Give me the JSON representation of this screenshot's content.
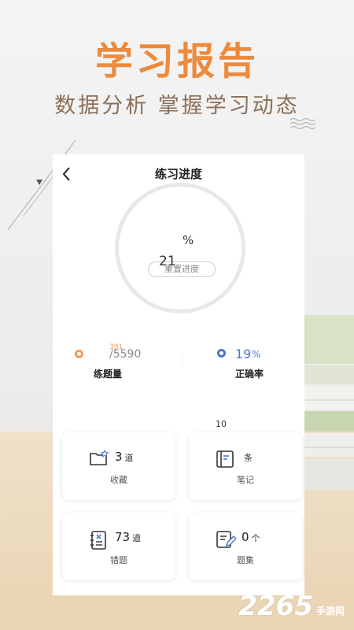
{
  "hero": {
    "title": "学习报告",
    "subtitle": "数据分析 掌握学习动态"
  },
  "watermark": {
    "number": "2265",
    "suffix": "手游网"
  },
  "screen": {
    "title": "练习进度",
    "progress": {
      "value": "21",
      "percent_sign": "%",
      "reset_label": "重置进度"
    },
    "practice": {
      "done": "391",
      "total": "/5590",
      "label": "练题量"
    },
    "accuracy": {
      "value": "19",
      "percent_sign": "%",
      "label": "正确率"
    },
    "floating_count": "10",
    "cards": {
      "favorites": {
        "count": "3",
        "unit": "道",
        "label": "收藏"
      },
      "notes": {
        "count": "",
        "unit": "条",
        "label": "笔记"
      },
      "wrong": {
        "count": "73",
        "unit": "道",
        "label": "错题"
      },
      "sets": {
        "count": "0",
        "unit": "个",
        "label": "题集"
      }
    }
  },
  "colors": {
    "accent": "#ee8a3c",
    "orange_dot": "#f29b57",
    "blue": "#4f75c8"
  },
  "icons": [
    "back-arrow-icon",
    "folder-star-icon",
    "notebook-icon",
    "wrong-book-icon",
    "edit-list-icon",
    "wave-icon"
  ]
}
